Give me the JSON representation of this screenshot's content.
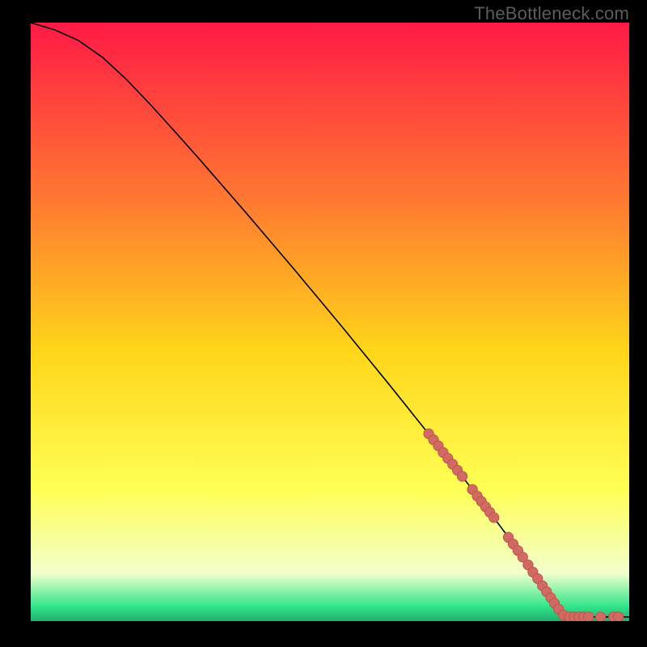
{
  "watermark": "TheBottleneck.com",
  "colors": {
    "background": "#000000",
    "gradient_top": "#ff1a46",
    "gradient_mid_upper": "#ff7a30",
    "gradient_mid": "#ffd61a",
    "gradient_mid_lower": "#ffff55",
    "gradient_low": "#f2ffcc",
    "gradient_green": "#34e68a",
    "curve": "#000000",
    "marker_fill": "#d16a63",
    "marker_stroke": "#b94f48"
  },
  "chart_data": {
    "type": "line",
    "title": "",
    "xlabel": "",
    "ylabel": "",
    "xlim": [
      0,
      100
    ],
    "ylim": [
      0,
      100
    ],
    "series": [
      {
        "name": "curve",
        "x": [
          0,
          4,
          8,
          12,
          16,
          20,
          24,
          28,
          32,
          36,
          40,
          44,
          48,
          52,
          56,
          60,
          64,
          68,
          72,
          76,
          80,
          82,
          84,
          86,
          88,
          90,
          92,
          94,
          96,
          98,
          100
        ],
        "y": [
          100,
          98.8,
          97.0,
          94.2,
          90.5,
          86.3,
          81.9,
          77.4,
          72.8,
          68.2,
          63.5,
          58.8,
          54.0,
          49.2,
          44.3,
          39.4,
          34.4,
          29.4,
          24.3,
          19.1,
          13.8,
          11.0,
          8.1,
          5.2,
          2.4,
          1.0,
          0.7,
          0.7,
          0.7,
          0.7,
          0.7
        ]
      }
    ],
    "markers": {
      "name": "dots",
      "points": [
        {
          "x": 66.5,
          "y": 31.3
        },
        {
          "x": 67.3,
          "y": 30.3
        },
        {
          "x": 68.1,
          "y": 29.3
        },
        {
          "x": 68.9,
          "y": 28.2
        },
        {
          "x": 69.7,
          "y": 27.2
        },
        {
          "x": 70.5,
          "y": 26.2
        },
        {
          "x": 71.3,
          "y": 25.2
        },
        {
          "x": 72.1,
          "y": 24.2
        },
        {
          "x": 73.8,
          "y": 22.0
        },
        {
          "x": 74.6,
          "y": 20.9
        },
        {
          "x": 75.3,
          "y": 20.0
        },
        {
          "x": 76.0,
          "y": 19.1
        },
        {
          "x": 76.7,
          "y": 18.2
        },
        {
          "x": 77.4,
          "y": 17.3
        },
        {
          "x": 79.8,
          "y": 14.0
        },
        {
          "x": 80.6,
          "y": 12.9
        },
        {
          "x": 81.4,
          "y": 11.8
        },
        {
          "x": 82.2,
          "y": 10.7
        },
        {
          "x": 83.1,
          "y": 9.4
        },
        {
          "x": 83.9,
          "y": 8.2
        },
        {
          "x": 84.7,
          "y": 7.1
        },
        {
          "x": 85.5,
          "y": 5.9
        },
        {
          "x": 86.2,
          "y": 4.9
        },
        {
          "x": 86.9,
          "y": 3.9
        },
        {
          "x": 87.5,
          "y": 3.0
        },
        {
          "x": 88.2,
          "y": 2.0
        },
        {
          "x": 89.0,
          "y": 1.0
        },
        {
          "x": 90.0,
          "y": 0.7
        },
        {
          "x": 90.8,
          "y": 0.7
        },
        {
          "x": 91.6,
          "y": 0.7
        },
        {
          "x": 92.4,
          "y": 0.7
        },
        {
          "x": 93.2,
          "y": 0.7
        },
        {
          "x": 95.2,
          "y": 0.7
        },
        {
          "x": 97.4,
          "y": 0.7
        },
        {
          "x": 98.2,
          "y": 0.7
        }
      ]
    }
  }
}
